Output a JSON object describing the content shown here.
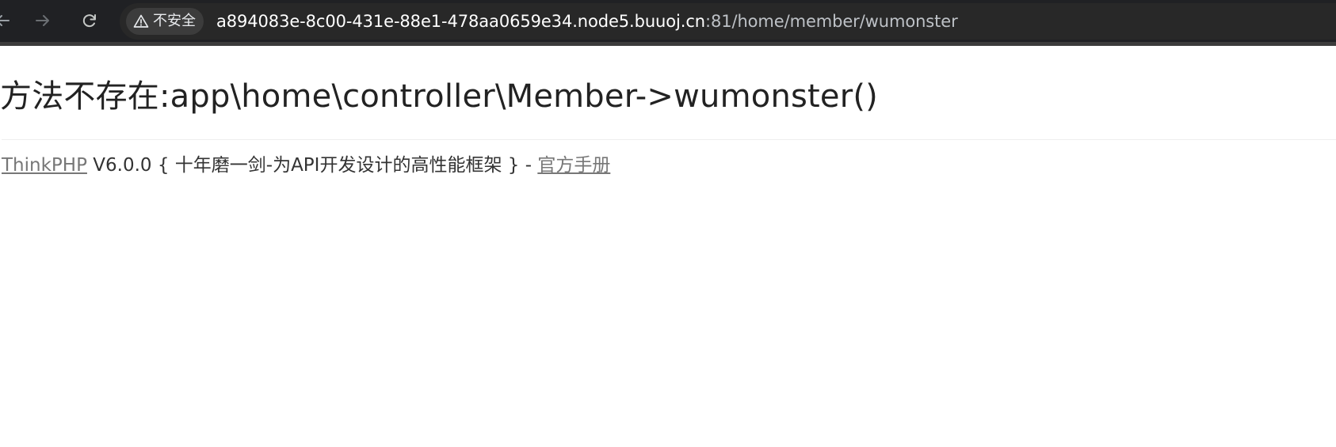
{
  "browser": {
    "security_label": "不安全",
    "url_host": "a894083e-8c00-431e-88e1-478aa0659e34.node5.buuoj.cn",
    "url_rest": ":81/home/member/wumonster",
    "icons": {
      "back": "back-arrow-icon",
      "forward": "forward-arrow-icon",
      "reload": "reload-icon",
      "security": "warning-triangle-icon"
    }
  },
  "page": {
    "error_title": "方法不存在:app\\home\\controller\\Member->wumonster()",
    "footer": {
      "framework_link": "ThinkPHP",
      "version_text": " V6.0.0 { 十年磨一剑-为API开发设计的高性能框架 } - ",
      "manual_link": "官方手册"
    }
  },
  "colors": {
    "toolbar_bg": "#202124",
    "omnibox_bg": "#282828",
    "chip_bg": "#3c3c3c",
    "title_text": "#222222",
    "link_text": "#777777"
  }
}
